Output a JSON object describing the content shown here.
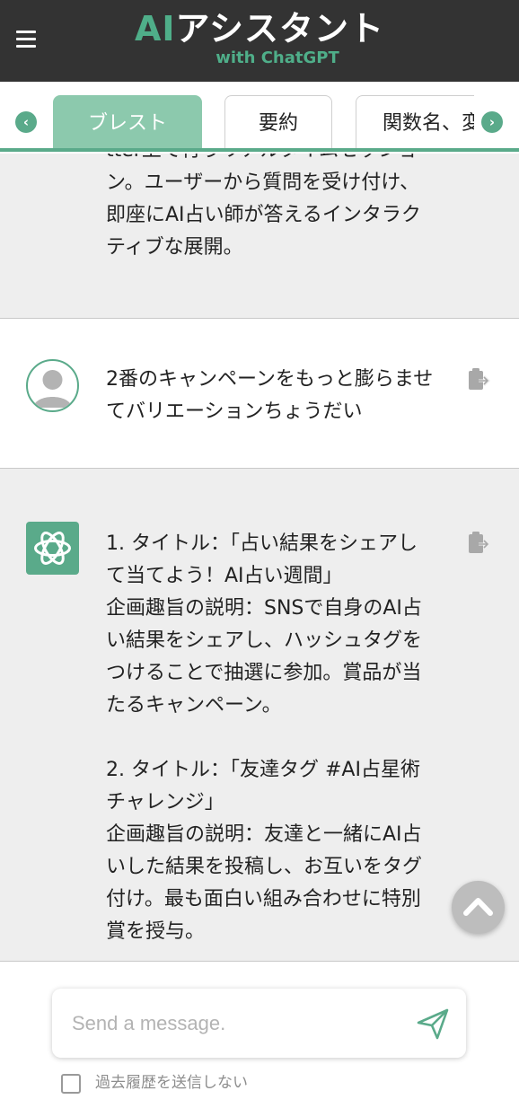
{
  "header": {
    "logo_ai": "AI",
    "logo_jp": "アシスタント",
    "logo_sub": "with ChatGPT",
    "menu_icon": "hamburger-menu-icon",
    "bg_color": "#333333",
    "accent_color": "#4fae89"
  },
  "tabs": {
    "prev_icon": "chevron-left-icon",
    "next_icon": "chevron-right-icon",
    "items": [
      {
        "label": "ブレスト",
        "active": true
      },
      {
        "label": "要約",
        "active": false
      },
      {
        "label": "関数名、変",
        "active": false
      }
    ]
  },
  "messages": [
    {
      "role": "assistant",
      "text": "tter上で行うリアルタイムセッション。ユーザーから質問を受け付け、即座にAI占い師が答えるインタラクティブな展開。"
    },
    {
      "role": "user",
      "text": "2番のキャンペーンをもっと膨らませてバリエーションちょうだい"
    },
    {
      "role": "assistant",
      "text": "1. タイトル：「占い結果をシェアして当てよう！AI占い週間」\n企画趣旨の説明：SNSで自身のAI占い結果をシェアし、ハッシュタグをつけることで抽選に参加。賞品が当たるキャンペーン。\n\n2. タイトル：「友達タグ #AI占星術 チャレンジ」\n企画趣旨の説明：友達と一緒にAI占いした結果を投稿し、お互いをタグ付け。最も面白い組み合わせに特別賞を授与。"
    }
  ],
  "icons": {
    "copy": "clipboard-copy-icon",
    "user_avatar": "user-avatar-icon",
    "ai_avatar": "openai-logo-icon",
    "scroll_top": "chevron-up-icon",
    "send": "send-icon"
  },
  "composer": {
    "placeholder": "Send a message.",
    "value": "",
    "history_checkbox_label": "過去履歴を送信しない",
    "history_checked": false
  }
}
